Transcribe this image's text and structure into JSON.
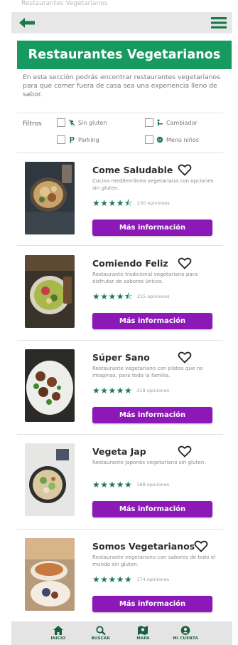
{
  "header": {
    "caption": "Restaurantes Vegetarianos",
    "back_icon": "arrow-left-icon",
    "menu_icon": "hamburger-menu-icon"
  },
  "page": {
    "title": "Restaurantes Vegetarianos",
    "intro": "En esta sección podrás encontrar restaurantes vegetarianos para que comer fuera de casa sea una experiencia lleno de sabor."
  },
  "filters": {
    "label": "Filtros",
    "items": [
      {
        "label": "Sin gluten",
        "icon": "no-gluten-icon",
        "checked": false
      },
      {
        "label": "Cambiador",
        "icon": "baby-changing-icon",
        "checked": false
      },
      {
        "label": "Parking",
        "icon": "parking-icon",
        "checked": false
      },
      {
        "label": "Menú niños",
        "icon": "kids-menu-icon",
        "checked": false
      }
    ]
  },
  "restaurants": [
    {
      "name": "Come Saludable",
      "description": "Cocina mediterránea vegetariana con opciones sin gluten.",
      "rating": 4.5,
      "stars": "★★★★⯪",
      "reviews": "230 opiniones",
      "button": "Más información",
      "favorite": false
    },
    {
      "name": "Comiendo Feliz",
      "description": "Restaurante tradicional vegetariano para disfrutar de sabores únicos.",
      "rating": 4.5,
      "stars": "★★★★⯪",
      "reviews": "215 opiniones",
      "button": "Más información",
      "favorite": false
    },
    {
      "name": "Súper Sano",
      "description": "Restaurante vegetariano con platos que no imaginas, para toda la familia.",
      "rating": 5,
      "stars": "★★★★★",
      "reviews": "318 opiniones",
      "button": "Más información",
      "favorite": false
    },
    {
      "name": "Vegeta Jap",
      "description": "Restaurante japonés vegetariano sin gluten.",
      "rating": 5,
      "stars": "★★★★★",
      "reviews": "168 opiniones",
      "button": "Más información",
      "favorite": false
    },
    {
      "name": "Somos Vegetarianos",
      "description": "Restaurante vegetariano con sabores de todo el mundo sin gluten.",
      "rating": 5,
      "stars": "★★★★★",
      "reviews": "174 opiniones",
      "button": "Más información",
      "favorite": false
    }
  ],
  "bottom_nav": [
    {
      "label": "INICIO",
      "icon": "home-icon"
    },
    {
      "label": "BUSCAR",
      "icon": "search-icon"
    },
    {
      "label": "MAPA",
      "icon": "map-icon"
    },
    {
      "label": "MI CUENTA",
      "icon": "account-icon"
    }
  ],
  "colors": {
    "brand_green": "#179a5f",
    "icon_green": "#1c7a4e",
    "button_purple": "#8c18b8",
    "bar_gray": "#e7e7e7"
  }
}
